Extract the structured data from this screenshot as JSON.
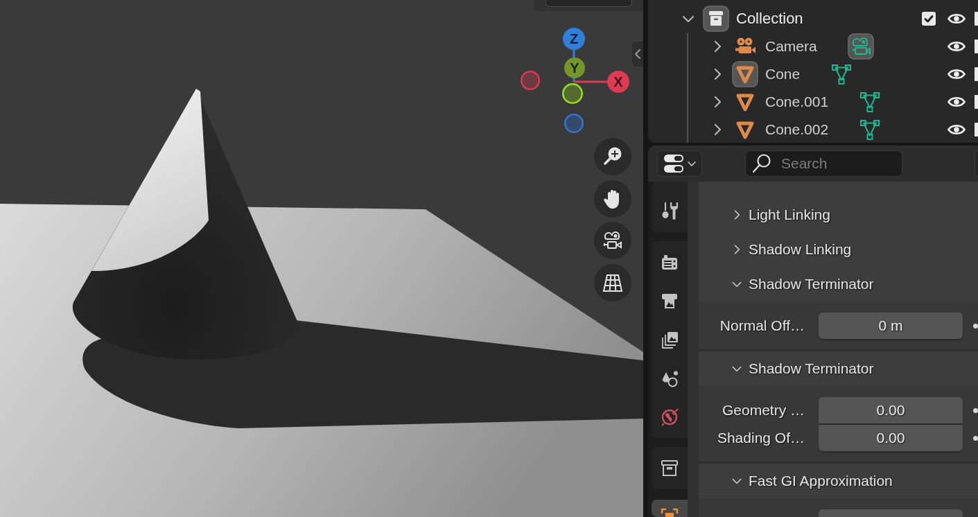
{
  "viewport": {
    "gizmo": [
      {
        "kind": "z",
        "label": "Z"
      },
      {
        "kind": "y",
        "label": "Y"
      },
      {
        "kind": "neg_x"
      },
      {
        "kind": "x",
        "label": "X"
      },
      {
        "kind": "neg_y"
      },
      {
        "kind": "neg_z"
      }
    ],
    "navigation": [
      {
        "kind": "zoom"
      },
      {
        "kind": "pan"
      },
      {
        "kind": "camera"
      },
      {
        "kind": "perspective"
      }
    ]
  },
  "outliner": {
    "items": [
      {
        "kind": "collection",
        "name": "Collection",
        "expanded": true,
        "active": true,
        "checked": true,
        "visible": true,
        "children": [
          {
            "kind": "camera",
            "name": "Camera",
            "expanded": false,
            "active": false,
            "data_active": true,
            "visible": true
          },
          {
            "kind": "mesh",
            "name": "Cone",
            "expanded": false,
            "active": true,
            "data_active": false,
            "visible": true
          },
          {
            "kind": "mesh",
            "name": "Cone.001",
            "expanded": false,
            "active": false,
            "data_active": false,
            "visible": true
          },
          {
            "kind": "mesh",
            "name": "Cone.002",
            "expanded": false,
            "active": false,
            "data_active": false,
            "visible": true
          }
        ]
      }
    ]
  },
  "properties": {
    "search": {
      "placeholder": "Search"
    },
    "tab_groups": [
      {
        "tabs": [
          {
            "kind": "tool",
            "selected": false
          }
        ]
      },
      {
        "tabs": [
          {
            "kind": "render",
            "selected": false
          },
          {
            "kind": "output",
            "selected": false
          },
          {
            "kind": "view_layer",
            "selected": false
          },
          {
            "kind": "scene",
            "selected": false
          },
          {
            "kind": "world",
            "selected": false
          }
        ]
      },
      {
        "tabs": [
          {
            "kind": "collection",
            "selected": false
          }
        ]
      },
      {
        "tabs": [
          {
            "kind": "object",
            "selected": true
          }
        ]
      }
    ],
    "sections": [
      {
        "kind": "header",
        "title": "Light Linking",
        "expanded": false
      },
      {
        "kind": "header",
        "title": "Shadow Linking",
        "expanded": false
      },
      {
        "kind": "header",
        "title": "Shadow Terminator",
        "expanded": true
      },
      {
        "kind": "fields",
        "fields": [
          {
            "kind": "number",
            "label": "Normal Off…",
            "value": "0 m"
          }
        ]
      },
      {
        "kind": "header",
        "title": "Shadow Terminator",
        "expanded": true
      },
      {
        "kind": "fields",
        "fields": [
          {
            "kind": "number",
            "label": "Geometry …",
            "value": "0.00"
          },
          {
            "kind": "number",
            "label": "Shading Of…",
            "value": "0.00"
          }
        ]
      },
      {
        "kind": "header",
        "title": "Fast GI Approximation",
        "expanded": true
      },
      {
        "kind": "fields",
        "fields": [
          {
            "kind": "clipped"
          }
        ]
      }
    ]
  }
}
